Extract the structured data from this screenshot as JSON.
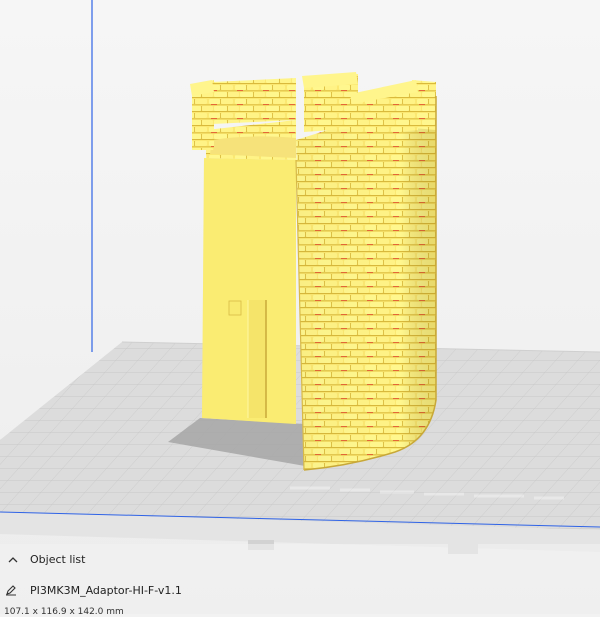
{
  "colors": {
    "model": "#fdf07a",
    "model_shadow": "#efd94a",
    "model_red": "#e44f2c",
    "bed": "#dcdcdc",
    "grid_line": "#c8c8c8",
    "axis_blue": "#2f63e6"
  },
  "object_panel": {
    "toggle_icon": "chevron-up-icon",
    "title": "Object list",
    "object_icon": "pencil-icon",
    "object_name": "PI3MK3M_Adaptor-HI-F-v1.1",
    "dimensions": "107.1 x 116.9 x 142.0 mm"
  }
}
